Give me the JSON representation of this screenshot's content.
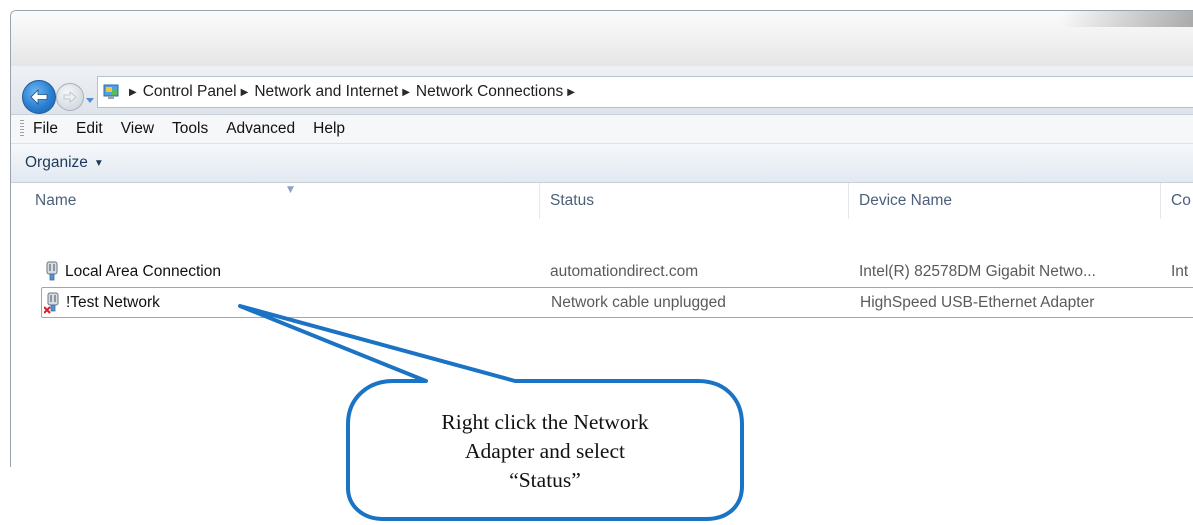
{
  "breadcrumb": {
    "items": [
      "Control Panel",
      "Network and Internet",
      "Network Connections"
    ]
  },
  "menu": {
    "items": [
      "File",
      "Edit",
      "View",
      "Tools",
      "Advanced",
      "Help"
    ]
  },
  "toolbar": {
    "organize_label": "Organize"
  },
  "columns": {
    "name": "Name",
    "status": "Status",
    "device": "Device Name",
    "extra": "Co"
  },
  "connections": [
    {
      "name": "Local Area Connection",
      "status": "automationdirect.com",
      "device": "Intel(R) 82578DM Gigabit Netwo...",
      "extra": "Int",
      "icon": "network-adapter-icon"
    },
    {
      "name": "!Test Network",
      "status": "Network cable unplugged",
      "device": "HighSpeed USB-Ethernet Adapter",
      "extra": "",
      "icon": "network-adapter-disconnected-icon"
    }
  ],
  "callout": {
    "lines": [
      "Right click the Network",
      "Adapter and select",
      "“Status”"
    ],
    "border_color": "#1a73c4"
  }
}
